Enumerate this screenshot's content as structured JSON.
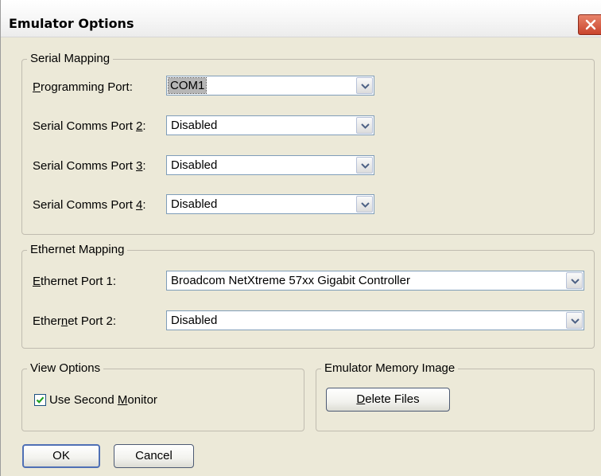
{
  "window": {
    "title": "Emulator Options"
  },
  "serial_mapping": {
    "legend": "Serial Mapping",
    "rows": [
      {
        "label_pre": "",
        "label_key": "P",
        "label_post": "rogramming Port:",
        "value": "COM1"
      },
      {
        "label_pre": "Serial Comms Port ",
        "label_key": "2",
        "label_post": ":",
        "value": "Disabled"
      },
      {
        "label_pre": "Serial Comms Port ",
        "label_key": "3",
        "label_post": ":",
        "value": "Disabled"
      },
      {
        "label_pre": "Serial Comms Port ",
        "label_key": "4",
        "label_post": ":",
        "value": "Disabled"
      }
    ]
  },
  "ethernet_mapping": {
    "legend": "Ethernet Mapping",
    "rows": [
      {
        "label_pre": "",
        "label_key": "E",
        "label_post": "thernet Port 1:",
        "value": "Broadcom NetXtreme 57xx Gigabit Controller"
      },
      {
        "label_pre": "Ether",
        "label_key": "n",
        "label_post": "et Port 2:",
        "value": "Disabled"
      }
    ]
  },
  "view_options": {
    "legend": "View Options",
    "checkbox": {
      "label_pre": "Use Second ",
      "label_key": "M",
      "label_post": "onitor",
      "checked": true
    }
  },
  "memory_image": {
    "legend": "Emulator Memory Image",
    "delete_key": "D",
    "delete_post": "elete Files"
  },
  "buttons": {
    "ok": "OK",
    "cancel": "Cancel"
  },
  "icons": {
    "close": "close-icon",
    "dropdown": "chevron-down-icon",
    "check": "check-icon"
  }
}
